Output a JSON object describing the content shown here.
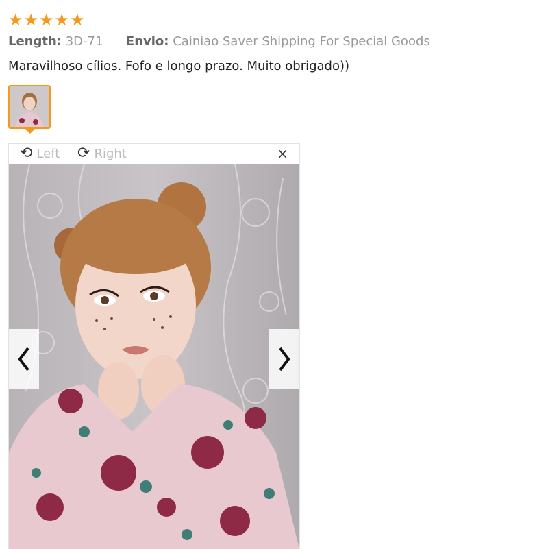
{
  "rating": {
    "stars": 5,
    "star_glyph": "★",
    "color": "#f29a1f"
  },
  "attributes": [
    {
      "key": "Length:",
      "value": "3D-71"
    },
    {
      "key": "Envio:",
      "value": "Cainiao Saver Shipping For Special Goods"
    }
  ],
  "review_text": "Maravilhoso cílios. Fofo e longo prazo. Muito obrigado))",
  "viewer": {
    "rotate_left_label": "Left",
    "rotate_right_label": "Right",
    "close_glyph": "×",
    "prev_icon": "chevron-left-icon",
    "next_icon": "chevron-right-icon"
  }
}
